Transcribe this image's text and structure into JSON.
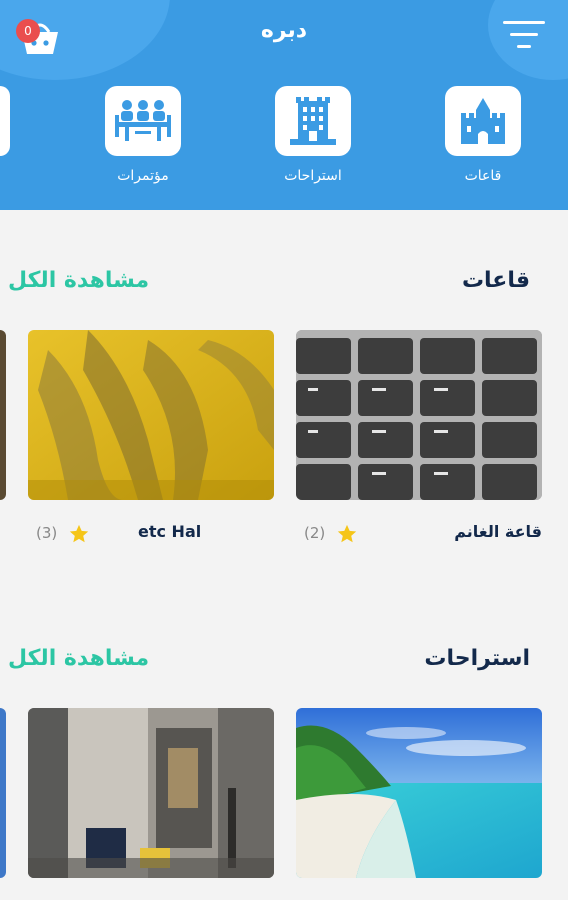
{
  "header": {
    "title": "دبره",
    "cart_count": "0"
  },
  "categories": [
    {
      "label": "قاعات",
      "icon": "castle-icon"
    },
    {
      "label": "استراحات",
      "icon": "tower-building-icon"
    },
    {
      "label": "مؤتمرات",
      "icon": "conference-meeting-icon"
    }
  ],
  "sections": [
    {
      "title": "قاعات",
      "see_all": "مشاهدة الكل",
      "cards": [
        {
          "name": "قاعة الغانم",
          "rating_count": "(2)"
        },
        {
          "name": "etc Hal",
          "rating_count": "(3)"
        }
      ]
    },
    {
      "title": "استراحات",
      "see_all": "مشاهدة الكل"
    }
  ],
  "colors": {
    "header": "#3b9be3",
    "accent": "#2cc6a4",
    "title": "#13294b",
    "star": "#f5c518",
    "badge": "#ea4e4e"
  }
}
